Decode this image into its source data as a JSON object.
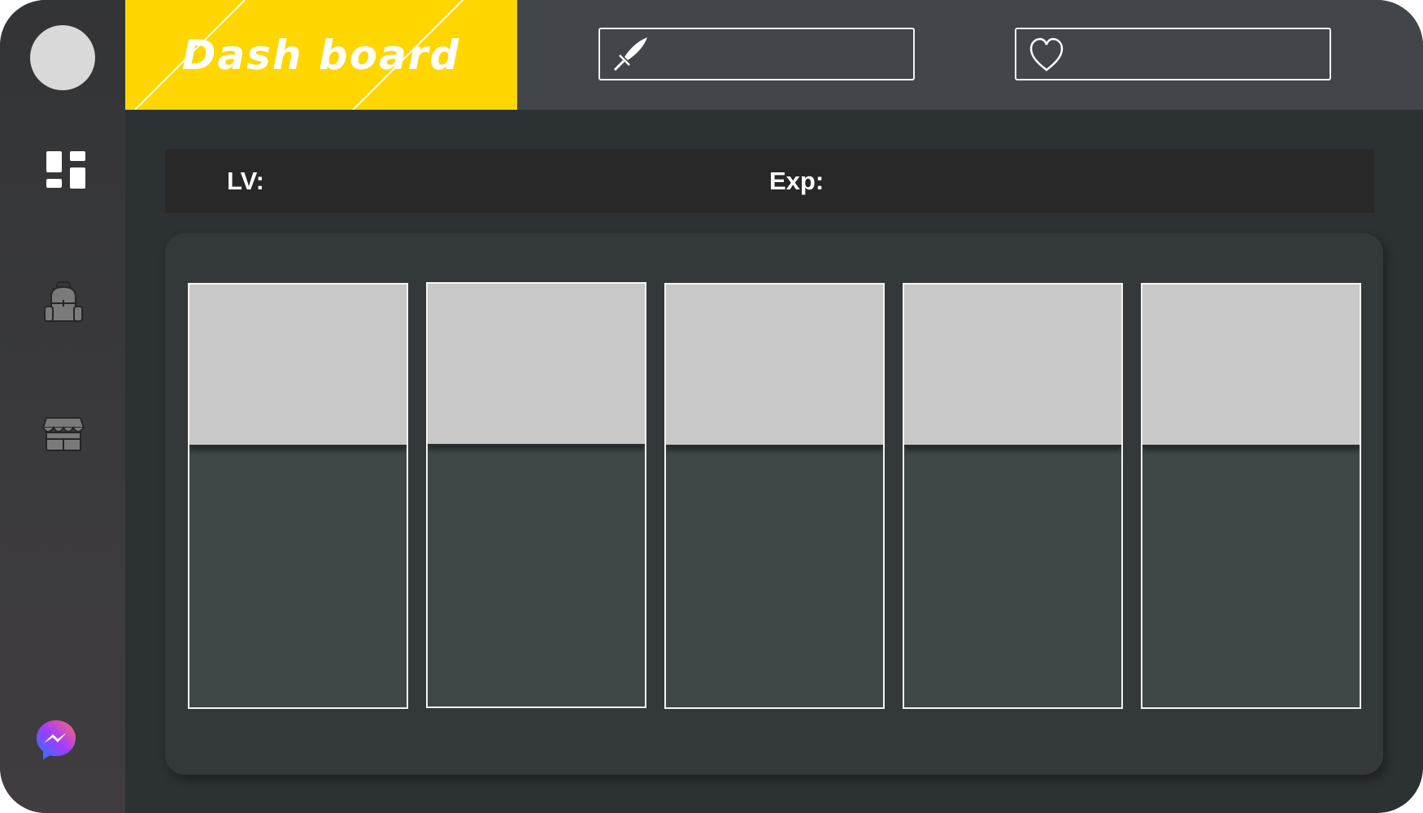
{
  "header": {
    "logo_text": "Dash board",
    "brand_color": "#ffd600",
    "attack_field": {
      "icon": "sword-icon",
      "value": ""
    },
    "health_field": {
      "icon": "heart-icon",
      "value": ""
    }
  },
  "sidebar": {
    "items": [
      {
        "name": "avatar"
      },
      {
        "name": "dashboard",
        "icon": "dashboard-icon"
      },
      {
        "name": "inventory",
        "icon": "backpack-icon"
      },
      {
        "name": "shop",
        "icon": "shop-icon"
      },
      {
        "name": "messenger",
        "icon": "messenger-icon"
      }
    ]
  },
  "stats": {
    "lv_label": "LV:",
    "lv_value": "",
    "exp_label": "Exp:",
    "exp_value": ""
  },
  "cards": [
    {
      "name": "slot-1"
    },
    {
      "name": "slot-2"
    },
    {
      "name": "slot-3"
    },
    {
      "name": "slot-4"
    },
    {
      "name": "slot-5"
    }
  ]
}
